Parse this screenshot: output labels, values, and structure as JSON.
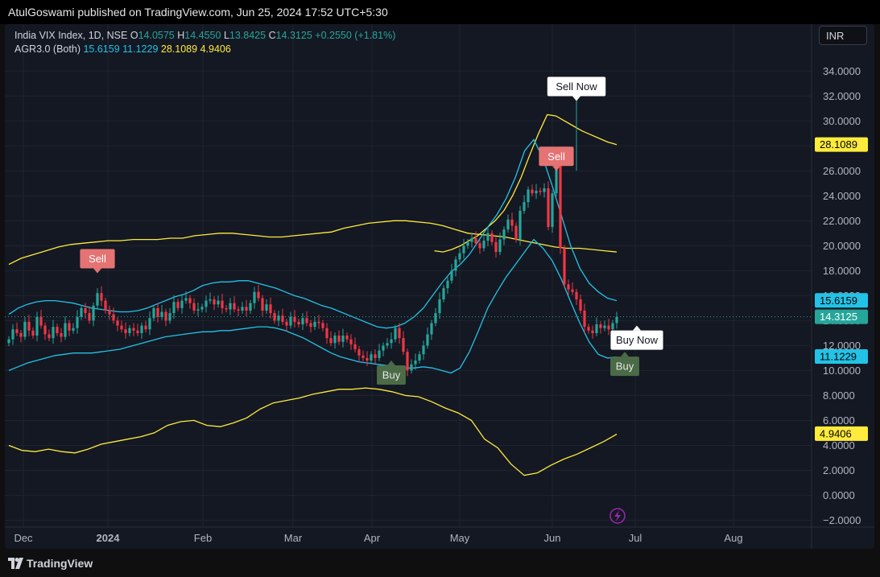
{
  "header": {
    "text": "AtulGoswami published on TradingView.com, Jun 25, 2024 17:52 UTC+5:30"
  },
  "legend": {
    "symbol": "India VIX Index, 1D, NSE",
    "o_label": "O",
    "o": "14.0575",
    "h_label": "H",
    "h": "14.4550",
    "l_label": "L",
    "l": "13.8425",
    "c_label": "C",
    "c": "14.3125",
    "change": "+0.2550 (+1.81%)",
    "indicator": "AGR3.0 (Both)",
    "v1": "15.6159",
    "v2": "11.1229",
    "v3": "28.1089",
    "v4": "4.9406"
  },
  "currency": "INR",
  "footer": {
    "brand": "TradingView"
  },
  "colors": {
    "up": "#26a69a",
    "down": "#f23645",
    "band_inner": "#22c3e6",
    "band_outer": "#ffeb3b",
    "sell": "#e57373",
    "buy": "#4a6b45",
    "bg": "#141823"
  },
  "chart_data": {
    "type": "candlestick",
    "y_ticks": [
      "34.0000",
      "32.0000",
      "30.0000",
      "28.0000",
      "26.0000",
      "24.0000",
      "22.0000",
      "20.0000",
      "18.0000",
      "16.0000",
      "14.0000",
      "12.0000",
      "10.0000",
      "8.0000",
      "6.0000",
      "4.0000",
      "2.0000",
      "0.0000",
      "−2.0000"
    ],
    "ylim": [
      -3,
      35.5
    ],
    "x_labels": [
      "Dec",
      "2024",
      "Feb",
      "Mar",
      "Apr",
      "May",
      "Jun",
      "Jul",
      "Aug"
    ],
    "price_tags": [
      {
        "label": "28.1089",
        "value": 28.11,
        "color": "#ffeb3b",
        "text_color": "#000000"
      },
      {
        "label": "15.6159",
        "value": 15.62,
        "color": "#22c3e6",
        "text_color": "#000000"
      },
      {
        "label": "14.3125",
        "value": 14.31,
        "color": "#26a69a",
        "text_color": "#ffffff"
      },
      {
        "label": "11.1229",
        "value": 11.12,
        "color": "#22c3e6",
        "text_color": "#000000"
      },
      {
        "label": "4.9406",
        "value": 4.94,
        "color": "#ffeb3b",
        "text_color": "#000000"
      }
    ],
    "last_price": 14.31,
    "signals": [
      {
        "label": "Sell",
        "index": 22,
        "value": 17.8,
        "kind": "sell"
      },
      {
        "label": "Buy",
        "index": 95,
        "value": 10.8,
        "kind": "buy"
      },
      {
        "label": "Sell Now",
        "index": 141,
        "value": 31.6,
        "kind": "sell_now"
      },
      {
        "label": "Sell",
        "index": 136,
        "value": 26.0,
        "kind": "sell"
      },
      {
        "label": "Buy Now",
        "index": 156,
        "value": 13.6,
        "kind": "buy_now"
      },
      {
        "label": "Buy",
        "index": 153,
        "value": 11.5,
        "kind": "buy"
      }
    ],
    "close": [
      12.5,
      13.3,
      13.0,
      12.7,
      13.9,
      13.2,
      12.8,
      14.3,
      13.6,
      12.9,
      12.6,
      13.5,
      13.0,
      12.7,
      13.8,
      13.2,
      13.4,
      14.3,
      15.0,
      14.6,
      14.0,
      15.2,
      16.2,
      15.6,
      14.8,
      14.5,
      14.0,
      13.6,
      13.3,
      13.0,
      13.4,
      13.2,
      13.0,
      13.6,
      13.3,
      14.2,
      15.0,
      14.3,
      14.7,
      14.0,
      14.6,
      15.5,
      15.0,
      15.6,
      15.8,
      15.4,
      14.8,
      14.9,
      15.1,
      15.6,
      15.7,
      15.3,
      15.6,
      15.0,
      14.9,
      15.4,
      14.9,
      14.8,
      15.1,
      14.8,
      15.4,
      16.3,
      15.8,
      14.8,
      15.3,
      14.6,
      14.0,
      14.4,
      13.9,
      13.6,
      14.3,
      13.9,
      13.7,
      14.2,
      13.8,
      13.5,
      13.9,
      13.8,
      13.4,
      12.6,
      12.2,
      12.8,
      12.3,
      12.8,
      12.5,
      12.1,
      11.7,
      11.2,
      11.0,
      10.8,
      11.3,
      11.0,
      11.6,
      12.0,
      12.2,
      12.5,
      13.4,
      12.6,
      11.5,
      10.0,
      10.5,
      10.8,
      11.3,
      12.0,
      12.9,
      13.8,
      14.6,
      15.7,
      16.6,
      17.2,
      18.0,
      18.9,
      19.4,
      20.0,
      20.3,
      20.6,
      20.2,
      19.8,
      20.4,
      21.0,
      20.3,
      19.5,
      20.5,
      21.3,
      22.1,
      21.6,
      20.5,
      22.8,
      23.5,
      24.5,
      24.2,
      24.4,
      24.3,
      24.6,
      21.5,
      24.2,
      26.8,
      19.8,
      16.9,
      16.5,
      16.3,
      15.7,
      14.8,
      13.5,
      13.2,
      13.0,
      13.7,
      13.4,
      13.6,
      13.3,
      13.8,
      14.3
    ],
    "upper_outer": [
      18.5,
      19.0,
      19.3,
      19.6,
      19.9,
      20.1,
      20.2,
      20.3,
      20.4,
      20.4,
      20.5,
      20.5,
      20.5,
      20.6,
      20.6,
      20.8,
      20.9,
      21.0,
      21.0,
      20.9,
      20.8,
      20.7,
      20.7,
      20.8,
      20.9,
      21.0,
      21.1,
      21.4,
      21.6,
      21.8,
      21.9,
      22.0,
      22.0,
      21.9,
      21.8,
      21.6,
      21.3,
      21.0,
      20.9,
      20.8,
      20.7,
      20.5,
      20.3,
      20.1,
      19.9,
      19.8,
      19.8,
      19.7,
      19.6,
      19.5
    ],
    "upper_inner": [
      14.5,
      15.0,
      15.3,
      15.5,
      15.6,
      15.6,
      15.5,
      15.4,
      15.2,
      15.0,
      14.9,
      14.8,
      14.7,
      14.7,
      14.8,
      15.0,
      15.3,
      15.6,
      15.9,
      16.1,
      16.4,
      16.8,
      17.0,
      17.1,
      17.1,
      17.2,
      17.2,
      17.0,
      16.8,
      16.6,
      16.3,
      16.0,
      15.8,
      15.5,
      15.2,
      15.0,
      14.7,
      14.4,
      14.1,
      13.8,
      13.5,
      13.4,
      13.5,
      13.8,
      14.3,
      15.0,
      16.0,
      17.0,
      17.9,
      18.5,
      19.3,
      20.4,
      21.5,
      22.5,
      23.8,
      25.5,
      27.6,
      28.5,
      27.0,
      24.8,
      22.4,
      20.0,
      18.2,
      17.0,
      16.3,
      15.8,
      15.6
    ],
    "lower_inner": [
      10.0,
      10.3,
      10.6,
      10.8,
      11.0,
      11.2,
      11.3,
      11.4,
      11.4,
      11.4,
      11.5,
      11.6,
      11.7,
      11.9,
      12.1,
      12.3,
      12.5,
      12.7,
      12.8,
      12.9,
      13.0,
      13.1,
      13.1,
      13.2,
      13.2,
      13.3,
      13.4,
      13.5,
      13.5,
      13.4,
      13.2,
      12.9,
      12.6,
      12.2,
      11.8,
      11.4,
      11.1,
      10.9,
      10.7,
      10.6,
      10.5,
      10.4,
      10.3,
      10.2,
      10.2,
      10.3,
      10.2,
      10.0,
      9.8,
      10.2,
      11.5,
      13.2,
      15.0,
      16.3,
      17.5,
      18.5,
      19.5,
      20.5,
      19.8,
      18.8,
      17.3,
      15.5,
      13.8,
      12.3,
      11.3,
      11.0,
      11.1
    ],
    "lower_outer": [
      4.0,
      3.6,
      3.5,
      3.7,
      3.5,
      3.4,
      3.7,
      4.1,
      4.3,
      4.5,
      4.7,
      5.0,
      5.6,
      5.9,
      6.0,
      5.6,
      5.5,
      5.8,
      6.2,
      6.9,
      7.4,
      7.6,
      7.8,
      8.1,
      8.3,
      8.5,
      8.5,
      8.6,
      8.5,
      8.3,
      8.0,
      7.9,
      7.5,
      7.0,
      6.6,
      6.0,
      4.5,
      3.8,
      2.5,
      1.6,
      1.8,
      2.4,
      2.9,
      3.3,
      3.8,
      4.3,
      4.9
    ]
  }
}
